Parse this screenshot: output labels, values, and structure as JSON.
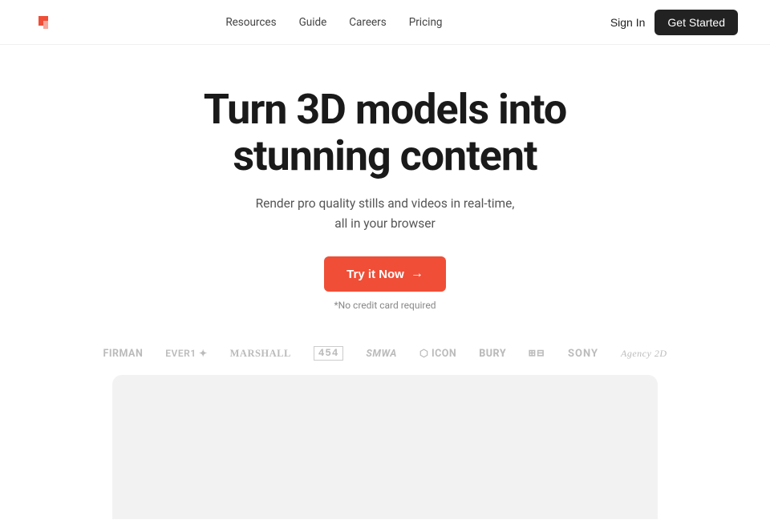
{
  "navbar": {
    "logo_alt": "Spline logo",
    "links": [
      {
        "label": "Resources",
        "id": "resources"
      },
      {
        "label": "Guide",
        "id": "guide"
      },
      {
        "label": "Careers",
        "id": "careers"
      },
      {
        "label": "Pricing",
        "id": "pricing"
      }
    ],
    "signin_label": "Sign In",
    "get_started_label": "Get Started"
  },
  "hero": {
    "title_line1": "Turn 3D models into",
    "title_line2": "stunning content",
    "subtitle_line1": "Render pro quality stills and videos in real-time,",
    "subtitle_line2": "all in your browser",
    "cta_label": "Try it Now",
    "cta_arrow": "→",
    "no_credit": "*No credit card required"
  },
  "brands": [
    {
      "label": "FIRMAN",
      "style": "normal"
    },
    {
      "label": "EVERI ⬡",
      "style": "normal"
    },
    {
      "label": "Marshall",
      "style": "serif"
    },
    {
      "label": "454",
      "style": "mono"
    },
    {
      "label": "SMWA",
      "style": "normal"
    },
    {
      "label": "⬡ ICON",
      "style": "normal"
    },
    {
      "label": "BURY",
      "style": "normal"
    },
    {
      "label": "⬛⬛",
      "style": "mono"
    },
    {
      "label": "SONY",
      "style": "normal"
    },
    {
      "label": "Agency 2D",
      "style": "serif"
    }
  ],
  "demo": {
    "alt": "3D rendering demo area"
  }
}
